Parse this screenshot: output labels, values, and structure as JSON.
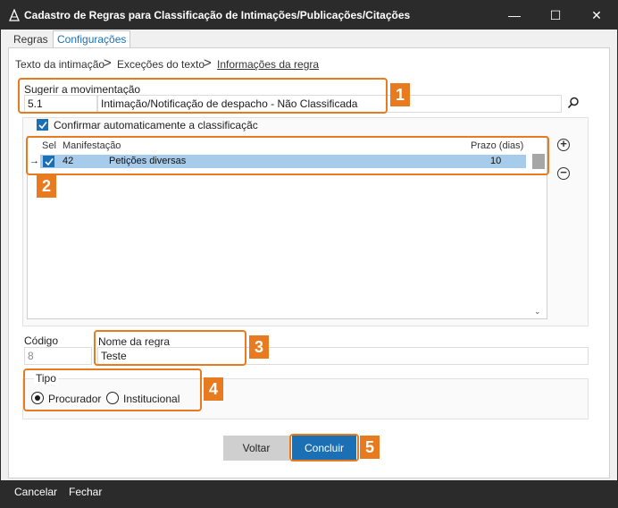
{
  "window": {
    "title": "Cadastro de Regras para Classificação de Intimações/Publicações/Citações",
    "controls": {
      "minimize": "—",
      "maximize": "☐",
      "close": "✕"
    }
  },
  "tabs": [
    {
      "label": "Regras",
      "active": false
    },
    {
      "label": "Configurações",
      "active": true
    }
  ],
  "breadcrumb": {
    "items": [
      "Texto da intimação",
      "Exceções do texto",
      "Informações da regra"
    ],
    "separator": ">"
  },
  "movimentacao": {
    "label": "Sugerir a movimentação",
    "code": "5.1",
    "description": "Intimação/Notificação de despacho - Não Classificada"
  },
  "auto_confirm": {
    "label": "Confirmar automaticamente a classificaçãc",
    "checked": true
  },
  "grid": {
    "headers": {
      "sel": "Sel",
      "manifestacao": "Manifestação",
      "prazo": "Prazo (dias)"
    },
    "rows": [
      {
        "pointer": "→",
        "selected": true,
        "code": "42",
        "name": "Petições diversas",
        "prazo": "10"
      }
    ]
  },
  "codigo": {
    "label": "Código",
    "value": "8"
  },
  "nome_regra": {
    "label": "Nome da regra",
    "value": "Teste"
  },
  "tipo": {
    "label": "Tipo",
    "options": [
      {
        "label": "Procurador",
        "selected": true
      },
      {
        "label": "Institucional",
        "selected": false
      }
    ]
  },
  "buttons": {
    "back": "Voltar",
    "done": "Concluir"
  },
  "footer": {
    "cancel": "Cancelar",
    "close": "Fechar"
  },
  "callouts": [
    "1",
    "2",
    "3",
    "4",
    "5"
  ],
  "colors": {
    "accent": "#1a6fb5",
    "callout": "#e87b1f",
    "titlebar": "#2b2b2b",
    "row_highlight": "#a7cbea"
  },
  "icons": {
    "search": "search-icon",
    "add": "add-circle-icon",
    "remove": "remove-circle-icon",
    "app": "app-icon"
  }
}
